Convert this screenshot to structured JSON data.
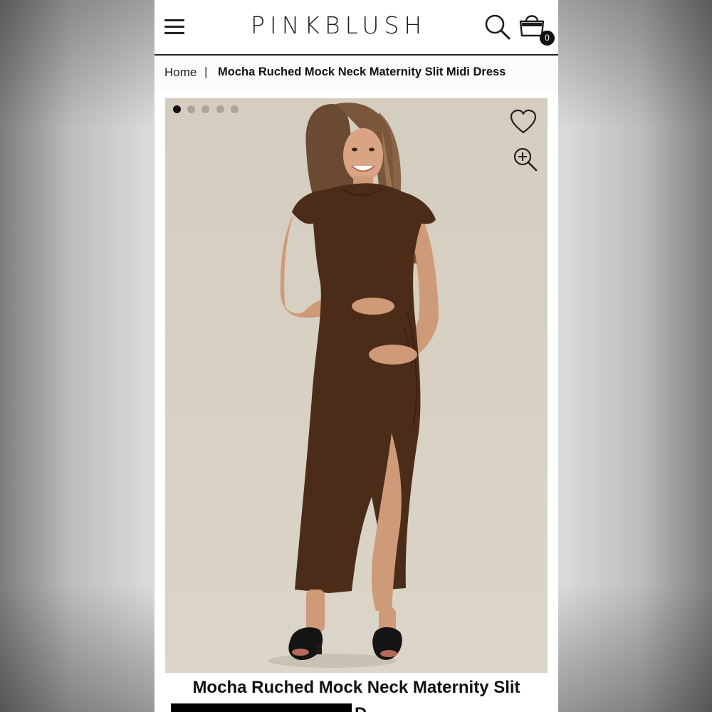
{
  "header": {
    "logo": "PINKBLUSH",
    "menu_icon": "hamburger-menu-icon",
    "search_icon": "search-icon",
    "bag_icon": "shopping-bag-icon",
    "bag_count": "0"
  },
  "breadcrumb": {
    "home": "Home",
    "separator": "|",
    "current": "Mocha Ruched Mock Neck Maternity Slit Midi Dress"
  },
  "gallery": {
    "image_count": 5,
    "active_index": 0,
    "wishlist_icon": "heart-icon",
    "zoom_icon": "zoom-in-icon",
    "background_color": "#d6cfc3",
    "dress_color": "#4a2c19"
  },
  "product": {
    "title_line1": "Mocha Ruched Mock Neck Maternity Slit",
    "title_line2_visible": "D"
  }
}
